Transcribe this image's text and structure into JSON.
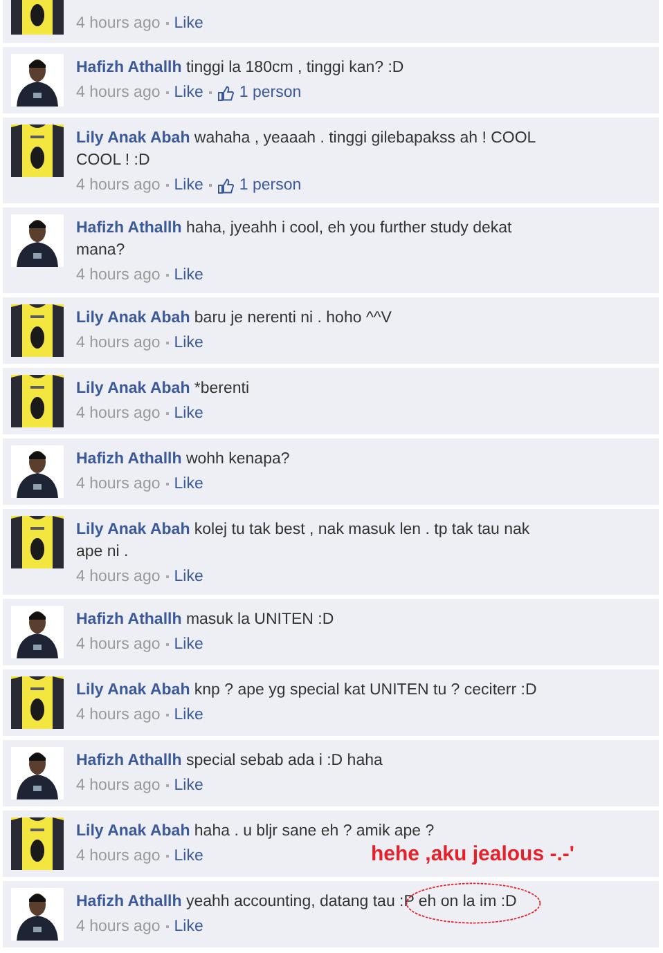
{
  "comments": [
    {
      "kind": "shirt",
      "time": "4 hours ago",
      "like": "Like"
    },
    {
      "kind": "person",
      "author": "Hafizh Athallh",
      "text": "tinggi la 180cm , tinggi kan? :D",
      "time": "4 hours ago",
      "like": "Like",
      "likes": "1 person"
    },
    {
      "kind": "shirt",
      "author": "Lily Anak Abah",
      "text": "wahaha , yeaaah . tinggi gilebapakss ah ! COOL COOL ! :D",
      "time": "4 hours ago",
      "like": "Like",
      "likes": "1 person"
    },
    {
      "kind": "person",
      "author": "Hafizh Athallh",
      "text": "haha, jyeahh i cool, eh you further study dekat mana?",
      "time": "4 hours ago",
      "like": "Like"
    },
    {
      "kind": "shirt",
      "author": "Lily Anak Abah",
      "text": "baru je nerenti ni . hoho ^^V",
      "time": "4 hours ago",
      "like": "Like"
    },
    {
      "kind": "shirt",
      "author": "Lily Anak Abah",
      "text": "*berenti",
      "time": "4 hours ago",
      "like": "Like"
    },
    {
      "kind": "person",
      "author": "Hafizh Athallh",
      "text": "wohh kenapa?",
      "time": "4 hours ago",
      "like": "Like"
    },
    {
      "kind": "shirt",
      "author": "Lily Anak Abah",
      "text": "kolej tu tak best , nak masuk len . tp tak tau nak ape ni .",
      "time": "4 hours ago",
      "like": "Like"
    },
    {
      "kind": "person",
      "author": "Hafizh Athallh",
      "text": "masuk la UNITEN :D",
      "time": "4 hours ago",
      "like": "Like"
    },
    {
      "kind": "shirt",
      "author": "Lily Anak Abah",
      "text": "knp ? ape yg special kat UNITEN tu ? ceciterr :D",
      "time": "4 hours ago",
      "like": "Like"
    },
    {
      "kind": "person",
      "author": "Hafizh Athallh",
      "text": "special sebab ada i :D haha",
      "time": "4 hours ago",
      "like": "Like"
    },
    {
      "kind": "shirt",
      "author": "Lily Anak Abah",
      "text": "haha . u bljr sane eh ? amik ape ?",
      "time": "4 hours ago",
      "like": "Like"
    },
    {
      "kind": "person",
      "author": "Hafizh Athallh",
      "text": "yeahh accounting, datang tau :P eh on la im :D",
      "time": "4 hours ago",
      "like": "Like"
    }
  ],
  "annotation": {
    "text": "hehe ,aku jealous -.-'"
  }
}
